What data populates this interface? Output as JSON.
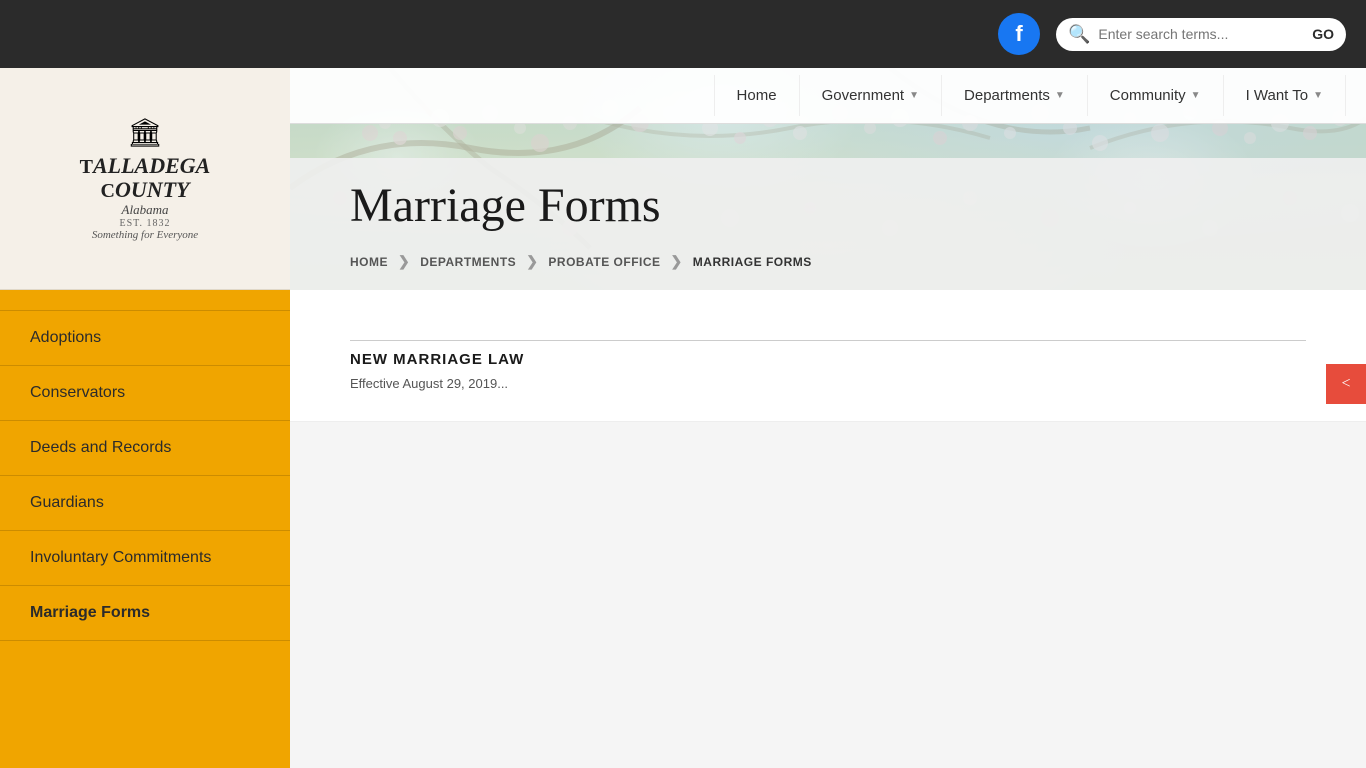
{
  "site": {
    "name": "Talladega County",
    "state": "Alabama",
    "est": "EST. 1832",
    "tagline": "Something for Everyone"
  },
  "topbar": {
    "facebook_letter": "f",
    "search_placeholder": "Enter search terms...",
    "search_go": "GO"
  },
  "nav": {
    "items": [
      {
        "label": "Home",
        "has_dropdown": false
      },
      {
        "label": "Government",
        "has_dropdown": true
      },
      {
        "label": "Departments",
        "has_dropdown": true
      },
      {
        "label": "Community",
        "has_dropdown": true
      },
      {
        "label": "I Want To",
        "has_dropdown": true
      }
    ]
  },
  "sidebar": {
    "items": [
      {
        "label": "Adoptions",
        "active": false
      },
      {
        "label": "Conservators",
        "active": false
      },
      {
        "label": "Deeds and Records",
        "active": false
      },
      {
        "label": "Guardians",
        "active": false
      },
      {
        "label": "Involuntary Commitments",
        "active": false
      },
      {
        "label": "Marriage Forms",
        "active": true
      }
    ]
  },
  "page": {
    "title": "Marriage Forms",
    "breadcrumb": {
      "home": "HOME",
      "departments": "DEPARTMENTS",
      "probate": "PROBATE OFFICE",
      "current": "MARRIAGE FORMS"
    },
    "new_law_title": "NEW MARRIAGE LAW",
    "new_law_subtitle": "Effective August 29, 2019..."
  },
  "share": {
    "icon": "⇄"
  }
}
